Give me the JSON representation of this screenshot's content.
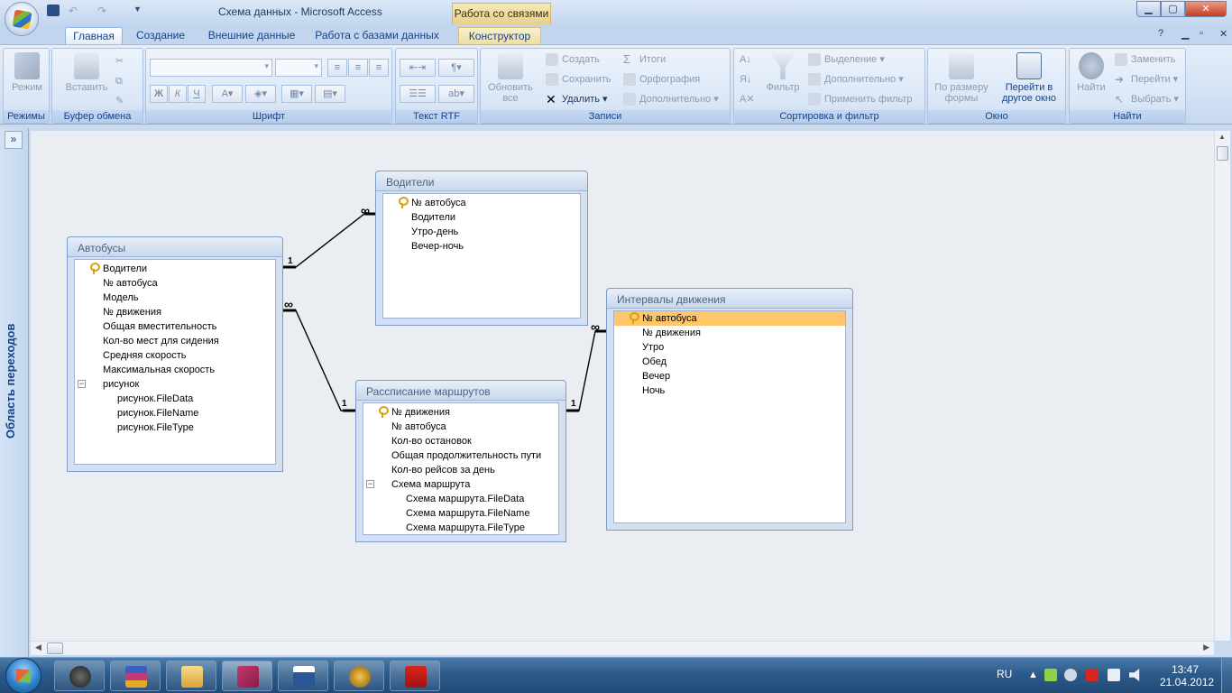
{
  "window": {
    "title": "Схема данных - Microsoft Access",
    "context_tab_group": "Работа со связями",
    "minimize": "▁",
    "maximize": "▢",
    "close": "✕"
  },
  "ribbon": {
    "tabs": [
      {
        "label": "Главная",
        "active": true
      },
      {
        "label": "Создание"
      },
      {
        "label": "Внешние данные"
      },
      {
        "label": "Работа с базами данных"
      },
      {
        "label": "Конструктор",
        "contextual": true
      }
    ],
    "help_icon": "?",
    "groups": {
      "modes": {
        "label": "Режимы",
        "view_btn": "Режим"
      },
      "clipboard": {
        "label": "Буфер обмена",
        "paste_btn": "Вставить"
      },
      "font": {
        "label": "Шрифт",
        "bold": "Ж",
        "italic": "К",
        "underline": "Ч"
      },
      "rtf": {
        "label": "Текст RTF"
      },
      "records": {
        "label": "Записи",
        "refresh_btn": "Обновить все",
        "create": "Создать",
        "save": "Сохранить",
        "delete": "Удалить",
        "totals": "Итоги",
        "spelling": "Орфография",
        "more": "Дополнительно"
      },
      "sort_filter": {
        "label": "Сортировка и фильтр",
        "filter_btn": "Фильтр",
        "selection": "Выделение",
        "advanced": "Дополнительно",
        "apply_filter": "Применить фильтр"
      },
      "window": {
        "label": "Окно",
        "fit_form": "По размеру формы",
        "switch_windows": "Перейти в другое окно"
      },
      "find": {
        "label": "Найти",
        "find_btn": "Найти",
        "replace": "Заменить",
        "goto": "Перейти",
        "select": "Выбрать"
      }
    }
  },
  "nav_pane": {
    "label": "Область переходов",
    "toggle": "»"
  },
  "tables": {
    "avtobusy": {
      "title": "Автобусы",
      "fields": [
        "Водители",
        "№ автобуса",
        "Модель",
        "№ движения",
        "Общая вместительность",
        "Кол-во мест для сидения",
        "Средняя скорость",
        "Максимальная скорость",
        "рисунок",
        "рисунок.FileData",
        "рисунок.FileName",
        "рисунок.FileType"
      ]
    },
    "voditeli": {
      "title": "Водители",
      "fields": [
        "№ автобуса",
        "Водители",
        "Утро-день",
        "Вечер-ночь"
      ]
    },
    "raspisanie": {
      "title": "Рассписание маршрутов",
      "fields": [
        "№ движения",
        "№ автобуса",
        "Кол-во остановок",
        "Общая продолжительность пути",
        "Кол-во рейсов за день",
        "Схема маршрута",
        "Схема маршрута.FileData",
        "Схема маршрута.FileName",
        "Схема маршрута.FileType"
      ]
    },
    "intervaly": {
      "title": "Интервалы движения",
      "fields": [
        "№ автобуса",
        "№ движения",
        "Утро",
        "Обед",
        "Вечер",
        "Ночь"
      ]
    }
  },
  "relationships": {
    "one": "1",
    "many": "∞"
  },
  "taskbar": {
    "lang": "RU",
    "time": "13:47",
    "date": "21.04.2012"
  }
}
